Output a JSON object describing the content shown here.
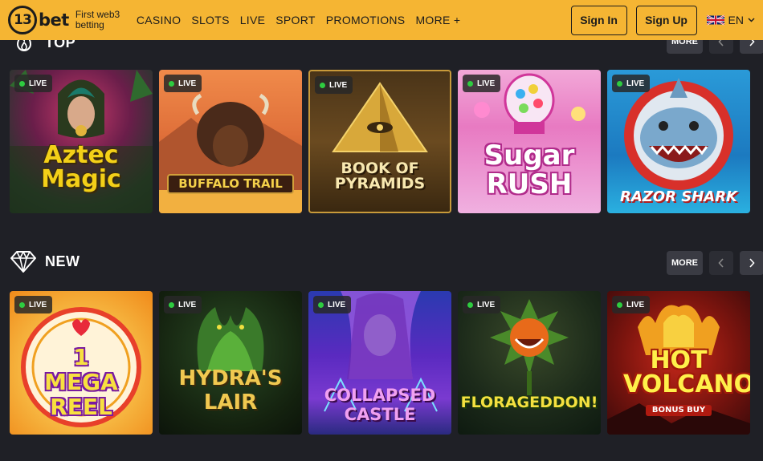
{
  "header": {
    "logo_number": "13",
    "logo_word": "bet",
    "tagline": "First web3 betting",
    "nav": [
      "CASINO",
      "SLOTS",
      "LIVE",
      "SPORT",
      "PROMOTIONS",
      "MORE +"
    ],
    "sign_in": "Sign In",
    "sign_up": "Sign Up",
    "language": "EN",
    "accent_color": "#f5b533"
  },
  "sections": {
    "top": {
      "title": "TOP",
      "icon": "fire-icon",
      "more": "MORE",
      "games": [
        {
          "title": "Aztec Magic",
          "badge": "LIVE"
        },
        {
          "title": "BUFFALO TRAIL",
          "badge": "LIVE"
        },
        {
          "title": "BOOK OF PYRAMIDS",
          "badge": "LIVE"
        },
        {
          "title": "Sugar RUSH",
          "badge": "LIVE"
        },
        {
          "title": "RAZOR SHARK",
          "badge": "LIVE"
        }
      ]
    },
    "new": {
      "title": "NEW",
      "icon": "diamond-icon",
      "more": "MORE",
      "games": [
        {
          "title": "1 MEGA REEL",
          "badge": "LIVE"
        },
        {
          "title": "HYDRA'S LAIR",
          "badge": "LIVE"
        },
        {
          "title": "COLLAPSED CASTLE",
          "badge": "LIVE"
        },
        {
          "title": "FLORAGEDDON!",
          "badge": "LIVE"
        },
        {
          "title": "HOT VOLCANO",
          "subtitle": "BONUS BUY",
          "badge": "LIVE"
        }
      ]
    }
  }
}
